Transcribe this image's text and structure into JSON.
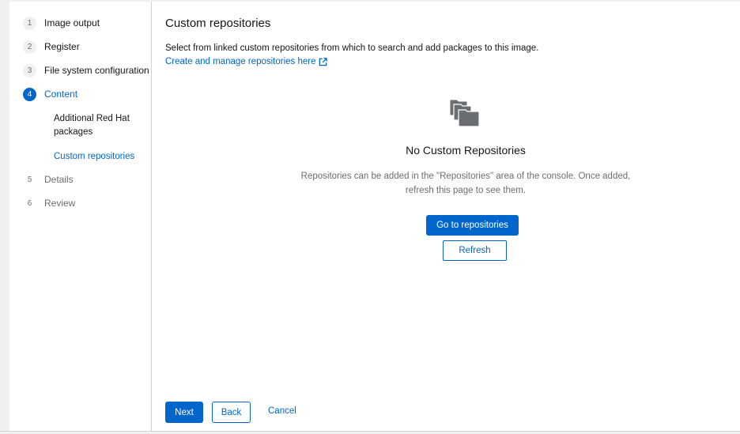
{
  "sidebar": {
    "steps": [
      {
        "num": "1",
        "label": "Image output"
      },
      {
        "num": "2",
        "label": "Register"
      },
      {
        "num": "3",
        "label": "File system configuration"
      },
      {
        "num": "4",
        "label": "Content"
      },
      {
        "num": "5",
        "label": "Details"
      },
      {
        "num": "6",
        "label": "Review"
      }
    ],
    "substeps": [
      {
        "label": "Additional Red Hat packages"
      },
      {
        "label": "Custom repositories"
      }
    ]
  },
  "main": {
    "title": "Custom repositories",
    "description": "Select from linked custom repositories from which to search and add packages to this image.",
    "manage_link": "Create and manage repositories here",
    "empty_state": {
      "icon": "folders-icon",
      "title": "No Custom Repositories",
      "body": "Repositories can be added in the \"Repositories\" area of the console. Once added, refresh this page to see them.",
      "primary_action": "Go to repositories",
      "secondary_action": "Refresh"
    }
  },
  "footer": {
    "next": "Next",
    "back": "Back",
    "cancel": "Cancel"
  },
  "colors": {
    "accent": "#0066cc",
    "muted_text": "#6a6e73"
  }
}
